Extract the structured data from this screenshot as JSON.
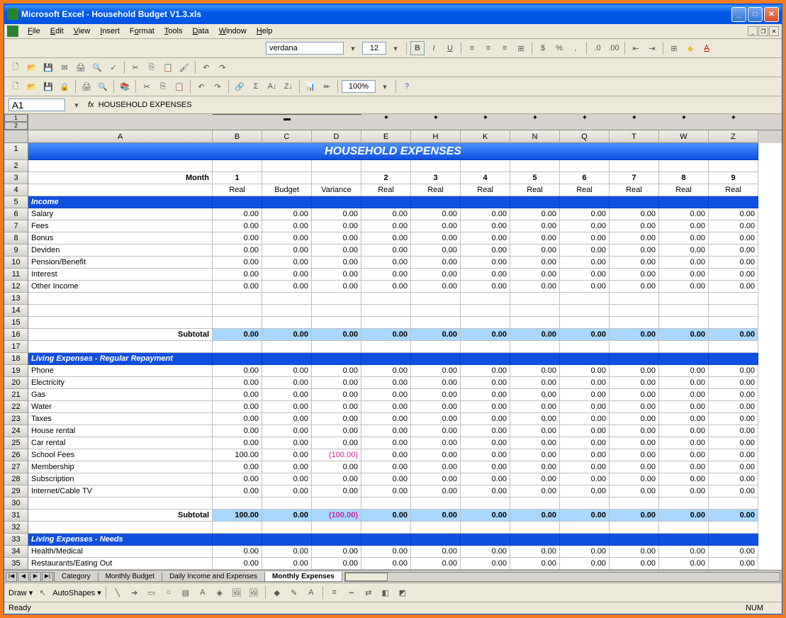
{
  "window": {
    "title": "Microsoft Excel - Household Budget V1.3.xls"
  },
  "menu": {
    "file": "File",
    "edit": "Edit",
    "view": "View",
    "insert": "Insert",
    "format": "Format",
    "tools": "Tools",
    "data": "Data",
    "window": "Window",
    "help": "Help"
  },
  "format_toolbar": {
    "font": "verdana",
    "size": "12",
    "zoom": "100%"
  },
  "namebox": {
    "cell": "A1",
    "formula": "HOUSEHOLD EXPENSES"
  },
  "columns": [
    "A",
    "B",
    "C",
    "D",
    "E",
    "H",
    "K",
    "N",
    "Q",
    "T",
    "W",
    "Z"
  ],
  "sheet": {
    "title": "HOUSEHOLD EXPENSES",
    "month_label": "Month",
    "months": [
      "1",
      "",
      "",
      "2",
      "3",
      "4",
      "5",
      "6",
      "7",
      "8",
      "9"
    ],
    "headers": [
      "Real",
      "Budget",
      "Variance",
      "Real",
      "Real",
      "Real",
      "Real",
      "Real",
      "Real",
      "Real",
      "Real"
    ],
    "sections": [
      {
        "name": "Income",
        "rows": [
          {
            "n": 6,
            "label": "Salary",
            "v": [
              "0.00",
              "0.00",
              "0.00",
              "0.00",
              "0.00",
              "0.00",
              "0.00",
              "0.00",
              "0.00",
              "0.00",
              "0.00"
            ]
          },
          {
            "n": 7,
            "label": "Fees",
            "v": [
              "0.00",
              "0.00",
              "0.00",
              "0.00",
              "0.00",
              "0.00",
              "0.00",
              "0.00",
              "0.00",
              "0.00",
              "0.00"
            ]
          },
          {
            "n": 8,
            "label": "Bonus",
            "v": [
              "0.00",
              "0.00",
              "0.00",
              "0.00",
              "0.00",
              "0.00",
              "0.00",
              "0.00",
              "0.00",
              "0.00",
              "0.00"
            ]
          },
          {
            "n": 9,
            "label": "Deviden",
            "v": [
              "0.00",
              "0.00",
              "0.00",
              "0.00",
              "0.00",
              "0.00",
              "0.00",
              "0.00",
              "0.00",
              "0.00",
              "0.00"
            ]
          },
          {
            "n": 10,
            "label": "Pension/Benefit",
            "v": [
              "0.00",
              "0.00",
              "0.00",
              "0.00",
              "0.00",
              "0.00",
              "0.00",
              "0.00",
              "0.00",
              "0.00",
              "0.00"
            ]
          },
          {
            "n": 11,
            "label": "Interest",
            "v": [
              "0.00",
              "0.00",
              "0.00",
              "0.00",
              "0.00",
              "0.00",
              "0.00",
              "0.00",
              "0.00",
              "0.00",
              "0.00"
            ]
          },
          {
            "n": 12,
            "label": "Other Income",
            "v": [
              "0.00",
              "0.00",
              "0.00",
              "0.00",
              "0.00",
              "0.00",
              "0.00",
              "0.00",
              "0.00",
              "0.00",
              "0.00"
            ]
          },
          {
            "n": 13,
            "label": "",
            "v": [
              "",
              "",
              "",
              "",
              "",
              "",
              "",
              "",
              "",
              "",
              ""
            ]
          },
          {
            "n": 14,
            "label": "",
            "v": [
              "",
              "",
              "",
              "",
              "",
              "",
              "",
              "",
              "",
              "",
              ""
            ]
          },
          {
            "n": 15,
            "label": "",
            "v": [
              "",
              "",
              "",
              "",
              "",
              "",
              "",
              "",
              "",
              "",
              ""
            ]
          }
        ],
        "subtotal": {
          "n": 16,
          "label": "Subtotal",
          "v": [
            "0.00",
            "0.00",
            "0.00",
            "0.00",
            "0.00",
            "0.00",
            "0.00",
            "0.00",
            "0.00",
            "0.00",
            "0.00"
          ]
        }
      },
      {
        "name": "Living Expenses - Regular Repayment",
        "rows": [
          {
            "n": 19,
            "label": "Phone",
            "v": [
              "0.00",
              "0.00",
              "0.00",
              "0.00",
              "0.00",
              "0.00",
              "0.00",
              "0.00",
              "0.00",
              "0.00",
              "0.00"
            ]
          },
          {
            "n": 20,
            "label": "Electricity",
            "v": [
              "0.00",
              "0.00",
              "0.00",
              "0.00",
              "0.00",
              "0.00",
              "0.00",
              "0.00",
              "0.00",
              "0.00",
              "0.00"
            ]
          },
          {
            "n": 21,
            "label": "Gas",
            "v": [
              "0.00",
              "0.00",
              "0.00",
              "0.00",
              "0.00",
              "0.00",
              "0.00",
              "0.00",
              "0.00",
              "0.00",
              "0.00"
            ]
          },
          {
            "n": 22,
            "label": "Water",
            "v": [
              "0.00",
              "0.00",
              "0.00",
              "0.00",
              "0.00",
              "0.00",
              "0.00",
              "0.00",
              "0.00",
              "0.00",
              "0.00"
            ]
          },
          {
            "n": 23,
            "label": "Taxes",
            "v": [
              "0.00",
              "0.00",
              "0.00",
              "0.00",
              "0.00",
              "0.00",
              "0.00",
              "0.00",
              "0.00",
              "0.00",
              "0.00"
            ]
          },
          {
            "n": 24,
            "label": "House rental",
            "v": [
              "0.00",
              "0.00",
              "0.00",
              "0.00",
              "0.00",
              "0.00",
              "0.00",
              "0.00",
              "0.00",
              "0.00",
              "0.00"
            ]
          },
          {
            "n": 25,
            "label": "Car rental",
            "v": [
              "0.00",
              "0.00",
              "0.00",
              "0.00",
              "0.00",
              "0.00",
              "0.00",
              "0.00",
              "0.00",
              "0.00",
              "0.00"
            ]
          },
          {
            "n": 26,
            "label": "School Fees",
            "v": [
              "100.00",
              "0.00",
              "(100.00)",
              "0.00",
              "0.00",
              "0.00",
              "0.00",
              "0.00",
              "0.00",
              "0.00",
              "0.00"
            ],
            "neg": [
              2
            ]
          },
          {
            "n": 27,
            "label": "Membership",
            "v": [
              "0.00",
              "0.00",
              "0.00",
              "0.00",
              "0.00",
              "0.00",
              "0.00",
              "0.00",
              "0.00",
              "0.00",
              "0.00"
            ]
          },
          {
            "n": 28,
            "label": "Subscription",
            "v": [
              "0.00",
              "0.00",
              "0.00",
              "0.00",
              "0.00",
              "0.00",
              "0.00",
              "0.00",
              "0.00",
              "0.00",
              "0.00"
            ]
          },
          {
            "n": 29,
            "label": "Internet/Cable TV",
            "v": [
              "0.00",
              "0.00",
              "0.00",
              "0.00",
              "0.00",
              "0.00",
              "0.00",
              "0.00",
              "0.00",
              "0.00",
              "0.00"
            ]
          },
          {
            "n": 30,
            "label": "",
            "v": [
              "",
              "",
              "",
              "",
              "",
              "",
              "",
              "",
              "",
              "",
              ""
            ]
          }
        ],
        "subtotal": {
          "n": 31,
          "label": "Subtotal",
          "v": [
            "100.00",
            "0.00",
            "(100.00)",
            "0.00",
            "0.00",
            "0.00",
            "0.00",
            "0.00",
            "0.00",
            "0.00",
            "0.00"
          ],
          "neg": [
            2
          ]
        }
      },
      {
        "name": "Living Expenses - Needs",
        "rows": [
          {
            "n": 34,
            "label": "Health/Medical",
            "v": [
              "0.00",
              "0.00",
              "0.00",
              "0.00",
              "0.00",
              "0.00",
              "0.00",
              "0.00",
              "0.00",
              "0.00",
              "0.00"
            ]
          },
          {
            "n": 35,
            "label": "Restaurants/Eating Out",
            "v": [
              "0.00",
              "0.00",
              "0.00",
              "0.00",
              "0.00",
              "0.00",
              "0.00",
              "0.00",
              "0.00",
              "0.00",
              "0.00"
            ]
          }
        ]
      }
    ]
  },
  "tabs": {
    "nav": [
      "|◀",
      "◀",
      "▶",
      "▶|"
    ],
    "items": [
      "Category",
      "Monthly Budget",
      "Daily Income and Expenses",
      "Monthly Expenses"
    ],
    "active": 3
  },
  "draw": {
    "label": "Draw",
    "autoshapes": "AutoShapes"
  },
  "status": {
    "ready": "Ready",
    "num": "NUM"
  }
}
